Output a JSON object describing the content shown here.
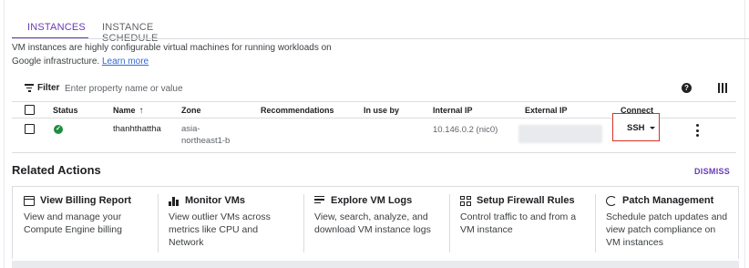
{
  "tabs": [
    {
      "label": "INSTANCES",
      "active": true
    },
    {
      "label": "INSTANCE SCHEDULE",
      "active": false
    }
  ],
  "description": {
    "text": "VM instances are highly configurable virtual machines for running workloads on Google infrastructure.",
    "link": "Learn more"
  },
  "filter": {
    "label": "Filter",
    "placeholder": "Enter property name or value",
    "help_icon": "help-icon",
    "columns_icon": "column-display-icon"
  },
  "table": {
    "headers": {
      "status": "Status",
      "name": "Name",
      "zone": "Zone",
      "recommendations": "Recommendations",
      "in_use_by": "In use by",
      "internal_ip": "Internal IP",
      "external_ip": "External IP",
      "connect": "Connect"
    },
    "rows": [
      {
        "status_icon": "check-circle-icon",
        "name": "thanhthattha",
        "zone_line1": "asia-",
        "zone_line2": "northeast1-b",
        "recommendations": "",
        "in_use_by": "",
        "internal_ip": "10.146.0.2 (nic0)",
        "external_ip": "",
        "connect": "SSH"
      }
    ]
  },
  "related": {
    "title": "Related Actions",
    "dismiss": "DISMISS",
    "cards": [
      {
        "icon": "billing-icon",
        "title": "View Billing Report",
        "desc_line1": "View and manage your",
        "desc_line2": "Compute Engine billing",
        "desc_line3": ""
      },
      {
        "icon": "monitoring-icon",
        "title": "Monitor VMs",
        "desc_line1": "View outlier VMs across",
        "desc_line2": "metrics like CPU and",
        "desc_line3": "Network"
      },
      {
        "icon": "logs-icon",
        "title": "Explore VM Logs",
        "desc_line1": "View, search, analyze, and",
        "desc_line2": "download VM instance logs",
        "desc_line3": ""
      },
      {
        "icon": "firewall-icon",
        "title": "Setup Firewall Rules",
        "desc_line1": "Control traffic to and from a",
        "desc_line2": "VM instance",
        "desc_line3": ""
      },
      {
        "icon": "patch-icon",
        "title": "Patch Management",
        "desc_line1": "Schedule patch updates and",
        "desc_line2": "view patch compliance on",
        "desc_line3": "VM instances"
      }
    ]
  },
  "colors": {
    "accent": "#673ab7",
    "status_ok": "#1e8e3e",
    "highlight_box": "#d93025"
  }
}
